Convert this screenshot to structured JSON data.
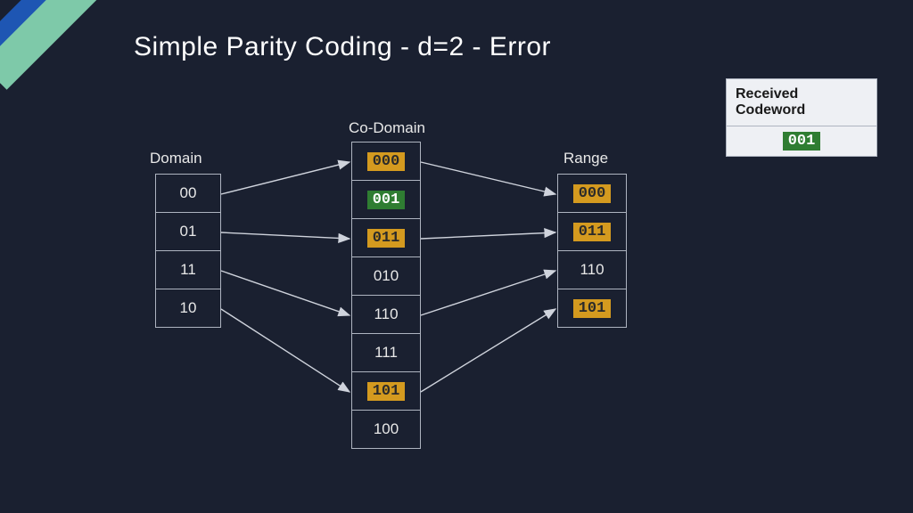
{
  "title": "Simple Parity Coding - d=2 - Error",
  "received": {
    "header": "Received Codeword",
    "value": "001"
  },
  "labels": {
    "domain": "Domain",
    "codomain": "Co-Domain",
    "range": "Range"
  },
  "domain": [
    "00",
    "01",
    "11",
    "10"
  ],
  "codomain": [
    {
      "v": "000",
      "hl": "amber"
    },
    {
      "v": "001",
      "hl": "green"
    },
    {
      "v": "011",
      "hl": "amber"
    },
    {
      "v": "010",
      "hl": "none"
    },
    {
      "v": "110",
      "hl": "none"
    },
    {
      "v": "111",
      "hl": "none"
    },
    {
      "v": "101",
      "hl": "amber"
    },
    {
      "v": "100",
      "hl": "none"
    }
  ],
  "range": [
    {
      "v": "000",
      "hl": "amber"
    },
    {
      "v": "011",
      "hl": "amber"
    },
    {
      "v": "110",
      "hl": "none"
    },
    {
      "v": "101",
      "hl": "amber"
    }
  ],
  "chart_data": {
    "type": "table",
    "title": "Simple Parity Coding - d=2 - Error",
    "mapping_domain_to_codomain": [
      {
        "from": "00",
        "to": "000"
      },
      {
        "from": "01",
        "to": "011"
      },
      {
        "from": "11",
        "to": "110"
      },
      {
        "from": "10",
        "to": "101"
      }
    ],
    "mapping_codomain_to_range": [
      {
        "from": "000",
        "to": "000"
      },
      {
        "from": "011",
        "to": "011"
      },
      {
        "from": "110",
        "to": "110"
      },
      {
        "from": "101",
        "to": "101"
      }
    ],
    "received_codeword": "001",
    "distance_d": 2,
    "highlighted_amber": [
      "000",
      "011",
      "101"
    ],
    "highlighted_green": [
      "001"
    ]
  }
}
